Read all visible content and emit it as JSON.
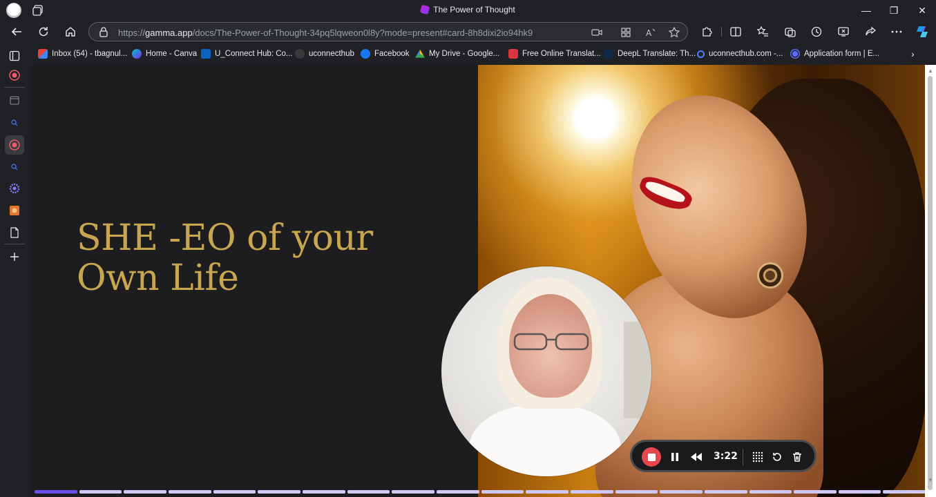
{
  "window": {
    "title": "The Power of Thought"
  },
  "toolbar": {
    "url_prefix": "https://",
    "url_host": "gamma.app",
    "url_path": "/docs/The-Power-of-Thought-34pq5lqweon0l8y?mode=present#card-8h8dixi2io94hk9"
  },
  "bookmarks": [
    {
      "label": "Inbox (54) - tbagnul...",
      "icon": "gmail-icon",
      "color": "#ea4335"
    },
    {
      "label": "Home - Canva",
      "icon": "canva-icon",
      "color": "#3b82f6"
    },
    {
      "label": "U_Connect Hub: Co...",
      "icon": "linkedin-icon",
      "color": "#0a66c2"
    },
    {
      "label": "uconnecthub",
      "icon": "uconnect-icon",
      "color": "#e2572b"
    },
    {
      "label": "Facebook",
      "icon": "facebook-icon",
      "color": "#1877f2"
    },
    {
      "label": "My Drive - Google...",
      "icon": "drive-icon",
      "color": "#34a853"
    },
    {
      "label": "Free Online Translat...",
      "icon": "translate-icon",
      "color": "#d9363e"
    },
    {
      "label": "DeepL Translate: Th...",
      "icon": "deepl-icon",
      "color": "#0f2b46"
    },
    {
      "label": "uconnecthub.com -...",
      "icon": "search-icon",
      "color": "#4f7cff"
    },
    {
      "label": "Application form | E...",
      "icon": "form-icon",
      "color": "#5b6cff"
    }
  ],
  "slide": {
    "headline": "SHE -EO of your Own Life",
    "accent_color": "#c7a64f"
  },
  "recorder": {
    "time": "3:22"
  },
  "progress": {
    "total_segments": 20,
    "current": 1
  }
}
